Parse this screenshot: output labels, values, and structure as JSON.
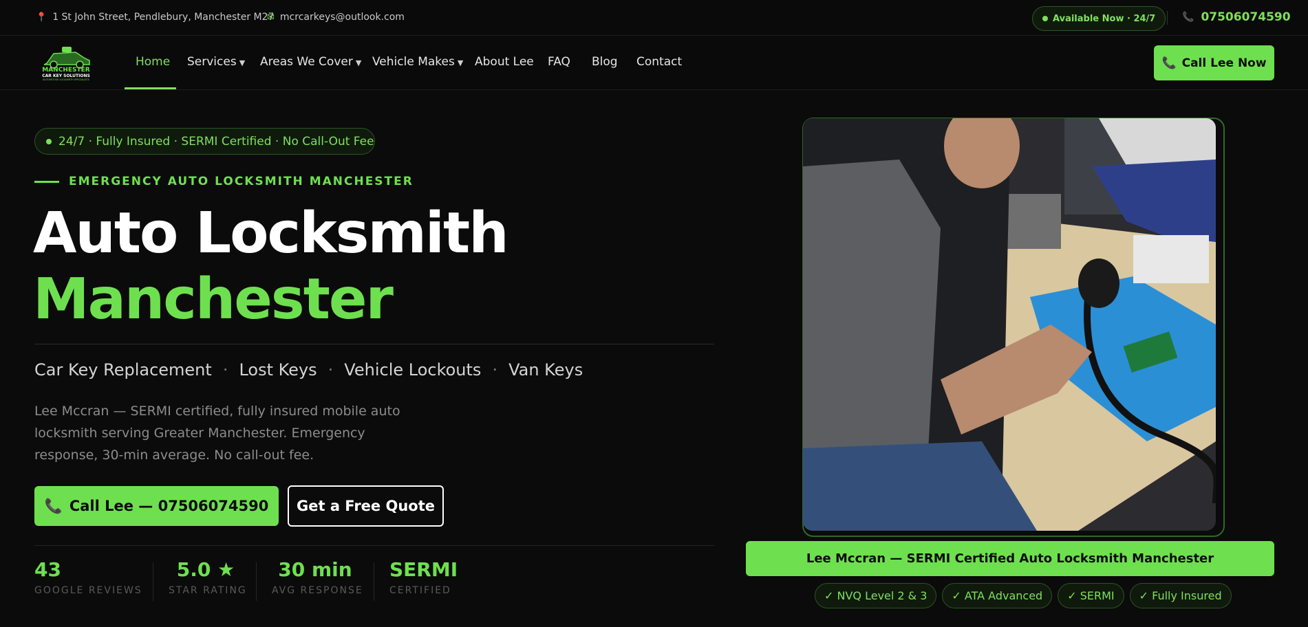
{
  "topbar": {
    "address": "1 St John Street, Pendlebury, Manchester M27",
    "email": "mcrcarkeys@outlook.com",
    "availability": "Available Now · 24/7",
    "phone": "07506074590"
  },
  "logo": {
    "line1": "MANCHESTER",
    "line2": "CAR KEY SOLUTIONS",
    "tagline": "AUTOMOTIVE LOCKSMITH SPECIALISTS"
  },
  "nav": {
    "items": [
      {
        "label": "Home",
        "active": true
      },
      {
        "label": "Services",
        "dropdown": true
      },
      {
        "label": "Areas We Cover",
        "dropdown": true
      },
      {
        "label": "Vehicle Makes",
        "dropdown": true
      },
      {
        "label": "About Lee"
      },
      {
        "label": "FAQ"
      },
      {
        "label": "Blog"
      },
      {
        "label": "Contact"
      }
    ],
    "cta": "Call Lee Now"
  },
  "hero": {
    "badge": "24/7 · Fully Insured · SERMI Certified · No Call-Out Fee",
    "eyebrow": "EMERGENCY AUTO LOCKSMITH MANCHESTER",
    "title_line1": "Auto Locksmith",
    "title_line2": "Manchester",
    "services": [
      "Car Key Replacement",
      "Lost Keys",
      "Vehicle Lockouts",
      "Van Keys"
    ],
    "separator": "·",
    "description": "Lee Mccran — SERMI certified, fully insured mobile auto locksmith serving Greater Manchester. Emergency response, 30-min average. No call-out fee.",
    "primary_button": "Call Lee — 07506074590",
    "secondary_button": "Get a Free Quote"
  },
  "stats": [
    {
      "value": "43",
      "label": "GOOGLE REVIEWS"
    },
    {
      "value": "5.0 ★",
      "label": "STAR RATING"
    },
    {
      "value": "30 min",
      "label": "AVG RESPONSE"
    },
    {
      "value": "SERMI",
      "label": "CERTIFIED"
    }
  ],
  "photo": {
    "caption": "Lee Mccran — SERMI Certified Auto Locksmith Manchester",
    "credentials": [
      "✓ NVQ Level 2 & 3",
      "✓ ATA Advanced",
      "✓ SERMI",
      "✓ Fully Insured"
    ]
  },
  "colors": {
    "accent": "#6ee04f",
    "background": "#0b0b0b"
  },
  "icons": [
    "location-pin-icon",
    "mail-icon",
    "phone-icon",
    "status-dot-icon",
    "caret-down-icon"
  ]
}
